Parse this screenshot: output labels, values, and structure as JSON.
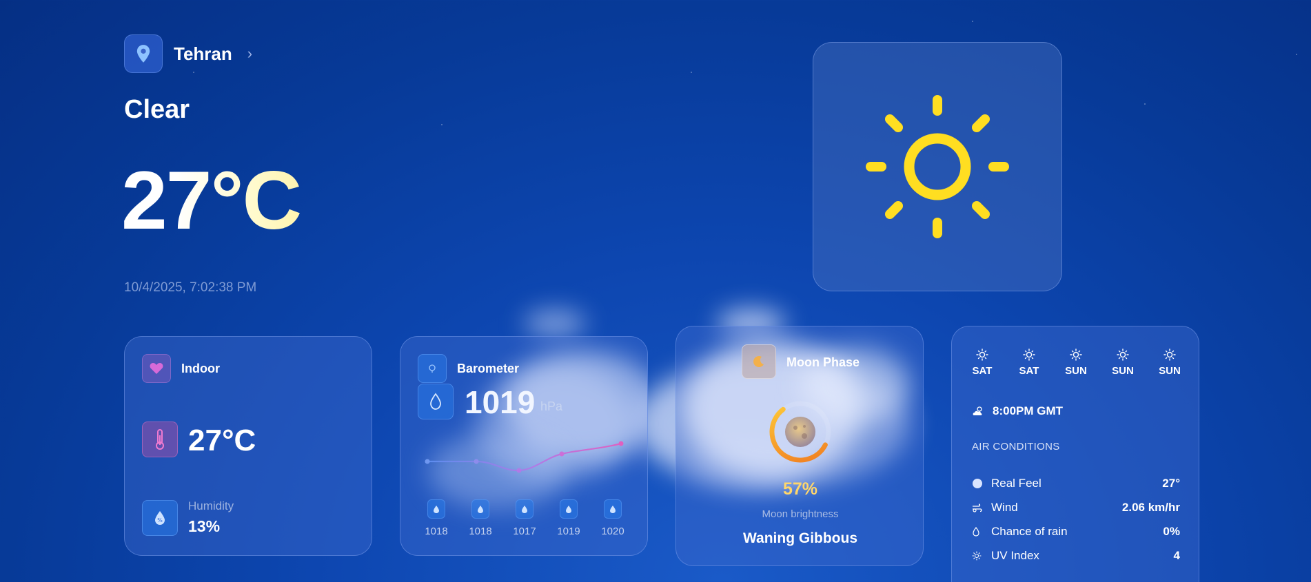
{
  "location": {
    "name": "Tehran",
    "pin_icon": "map-pin-icon",
    "chevron_icon": "chevron-right-icon"
  },
  "current": {
    "condition": "Clear",
    "temperature": "27°C",
    "datetime": "10/4/2025, 7:02:38 PM",
    "weather_icon": "sun-icon"
  },
  "indoor": {
    "title": "Indoor",
    "temperature": "27°C",
    "humidity_label": "Humidity",
    "humidity_value": "13%"
  },
  "barometer": {
    "title": "Barometer",
    "value": "1019",
    "unit": "hPa",
    "readings": [
      "1018",
      "1018",
      "1017",
      "1019",
      "1020"
    ]
  },
  "moon": {
    "title": "Moon Phase",
    "brightness_pct": "57%",
    "brightness_label": "Moon brightness",
    "phase_name": "Waning Gibbous",
    "brightness": 0.57
  },
  "forecast": {
    "days": [
      "SAT",
      "SAT",
      "SUN",
      "SUN",
      "SUN"
    ],
    "time": "8:00PM GMT"
  },
  "air_conditions": {
    "title": "AIR CONDITIONS",
    "items": [
      {
        "label": "Real Feel",
        "value": "27°",
        "icon": "dot-icon"
      },
      {
        "label": "Wind",
        "value": "2.06 km/hr",
        "icon": "wind-icon"
      },
      {
        "label": "Chance of rain",
        "value": "0%",
        "icon": "raindrop-icon"
      },
      {
        "label": "UV Index",
        "value": "4",
        "icon": "uv-sun-icon"
      }
    ]
  },
  "colors": {
    "accent_yellow": "#ffde21",
    "moon_ring": "#f5a623",
    "pressure_line_start": "#5b8dee",
    "pressure_line_end": "#e060c0"
  }
}
